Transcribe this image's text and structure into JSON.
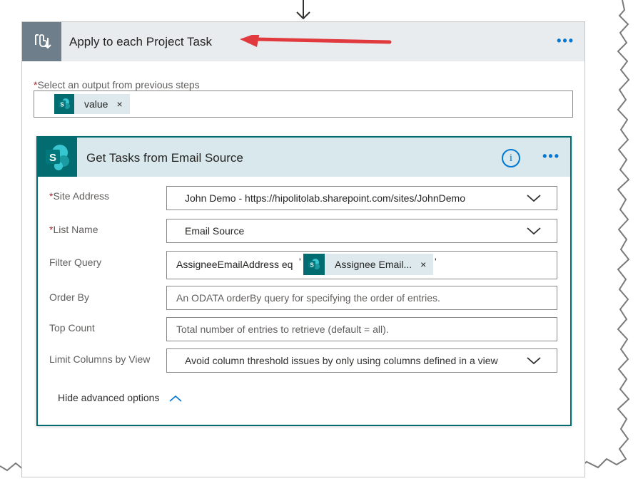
{
  "apply_card": {
    "title": "Apply to each Project Task",
    "more_label": "•••",
    "output_label": "Select an output from previous steps",
    "required_mark": "*",
    "token": {
      "label": "value",
      "remove": "×",
      "icon": "sharepoint-icon"
    }
  },
  "action_card": {
    "title": "Get Tasks from Email Source",
    "info_label": "i",
    "more_label": "•••",
    "fields": {
      "site_address": {
        "label": "Site Address",
        "required": "*",
        "value": "John Demo - https://hipolitolab.sharepoint.com/sites/JohnDemo"
      },
      "list_name": {
        "label": "List Name",
        "required": "*",
        "value": "Email Source"
      },
      "filter_query": {
        "label": "Filter Query",
        "prefix": "AssigneeEmailAddress eq",
        "quote": "'",
        "token_label": "Assignee Email...",
        "token_remove": "×"
      },
      "order_by": {
        "label": "Order By",
        "placeholder": "An ODATA orderBy query for specifying the order of entries."
      },
      "top_count": {
        "label": "Top Count",
        "placeholder": "Total number of entries to retrieve (default = all)."
      },
      "limit_columns": {
        "label": "Limit Columns by View",
        "value": "Avoid column threshold issues by only using columns defined in a view"
      }
    },
    "hide_advanced": "Hide advanced options"
  },
  "colors": {
    "accent": "#0078d4",
    "sharepoint": "#036c70",
    "annotation_arrow": "#e03a3e"
  }
}
